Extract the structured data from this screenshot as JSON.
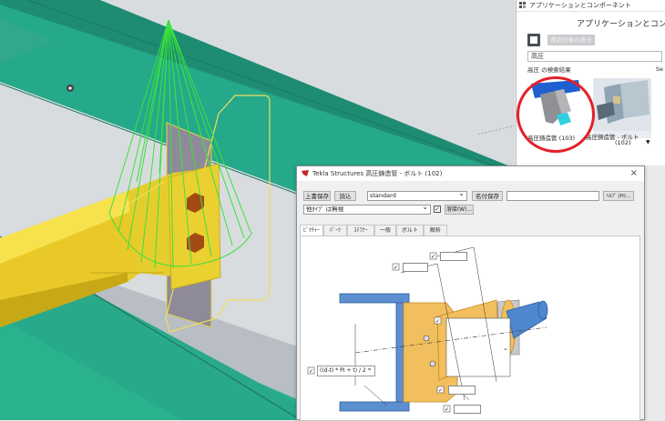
{
  "panel": {
    "title": "アプリケーションとコンポーネント",
    "header": "アプリケーションとコンポーネント",
    "show_selected_label": "選択対象の表示",
    "search_value": "高圧",
    "results_label": "高圧 の検索結果",
    "results_right": "Se",
    "items": [
      {
        "label": "高圧鋳造管 (103)"
      },
      {
        "label": "高圧鋳造管 - ボルト",
        "sub": "(102)"
      }
    ]
  },
  "dialog": {
    "title": "Tekla Structures  高圧鋳造管 - ボルト (102)",
    "save_btn": "上書保存",
    "load_btn": "読込",
    "preset_value": "standard",
    "save_as_btn": "名付保存",
    "help_btn": "ﾍﾙﾌﾟ (H)...",
    "type_value": "他ﾀｲﾌﾟ は無視",
    "weld_btn": "溶接(W)...",
    "tabs": [
      "ﾋﾟｸﾁｬｰ",
      "ﾊﾟｰﾂ",
      "ｽﾃﾌﾅｰ",
      "一般",
      "ボルト",
      "解析"
    ],
    "formula_value": "((d-t) * PI + t) / 2"
  }
}
